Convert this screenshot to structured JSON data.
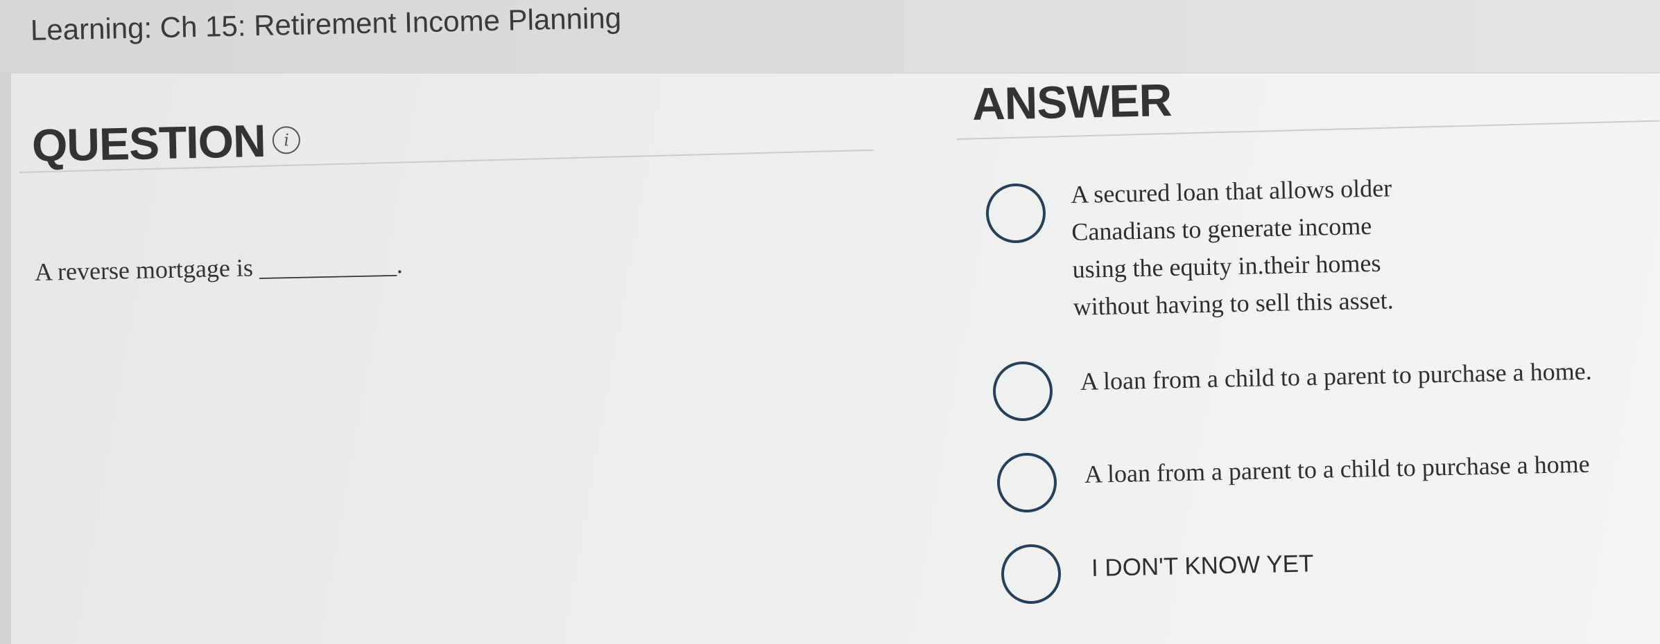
{
  "header": {
    "course_title": "Learning: Ch 15: Retirement Income Planning"
  },
  "question": {
    "heading": "QUESTION",
    "info_icon": "info-icon",
    "text": "A reverse mortgage is ___________."
  },
  "answer": {
    "heading": "ANSWER",
    "options": [
      {
        "lines": [
          "A secured loan that allows older",
          "Canadians to generate income",
          "using the equity in.their homes",
          "without having to sell this asset."
        ]
      },
      {
        "lines": [
          "A loan from a child to a parent to purchase a home."
        ]
      },
      {
        "lines": [
          "A loan from a parent to a child to purchase a home"
        ]
      },
      {
        "lines": [
          "I DON'T KNOW YET"
        ]
      }
    ]
  },
  "colors": {
    "radio_border": "#27405a",
    "heading_text": "#333333"
  }
}
